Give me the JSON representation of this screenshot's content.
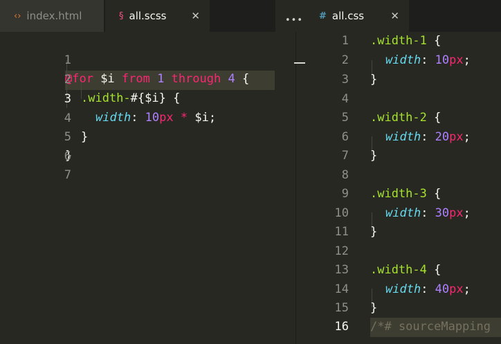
{
  "tabs_left": [
    {
      "label": "index.html",
      "icon": "html-icon",
      "icon_glyph": "‹›",
      "icon_color": "#e37933",
      "active": false
    },
    {
      "label": "all.scss",
      "icon": "sass-icon",
      "icon_glyph": "§",
      "icon_color": "#f55385",
      "active": true,
      "close_glyph": "✕"
    }
  ],
  "tabs_right": [
    {
      "label": "all.css",
      "icon": "css-icon",
      "icon_glyph": "#",
      "icon_color": "#519aba",
      "active": true,
      "close_glyph": "✕"
    }
  ],
  "more_glyph": "•••",
  "left_editor": {
    "current_line": 3,
    "line_numbers": [
      "1",
      "2",
      "3",
      "4",
      "5",
      "6",
      "7"
    ]
  },
  "right_editor": {
    "current_line": 16,
    "line_numbers": [
      "1",
      "2",
      "3",
      "4",
      "5",
      "6",
      "7",
      "8",
      "9",
      "10",
      "11",
      "12",
      "13",
      "14",
      "15",
      "16"
    ]
  },
  "tokens": {
    "at_for": "@for",
    "var_i": " $i ",
    "from": "from",
    "one": " 1 ",
    "through": "through",
    "four": " 4 ",
    "brace_open": "{",
    "sel_prefix": ".width-",
    "interp": "#{$i}",
    "brace_sp": " {",
    "width_prop": "width",
    "colon": ": ",
    "ten": "10",
    "px": "px",
    "star": " * ",
    "var_i2": "$i;",
    "brace_close": "}",
    "css_sel_1": ".width-1",
    "css_sel_2": ".width-2",
    "css_sel_3": ".width-3",
    "css_sel_4": ".width-4",
    "n10": "10",
    "n20": "20",
    "n30": "30",
    "n40": "40",
    "semi": ";",
    "source_map": "/*# sourceMapping"
  },
  "colors": {
    "bg": "#272822",
    "keyword": "#f92672",
    "number": "#ae81ff",
    "selector": "#a6e22e",
    "property": "#66d9ef",
    "comment": "#75715e"
  }
}
